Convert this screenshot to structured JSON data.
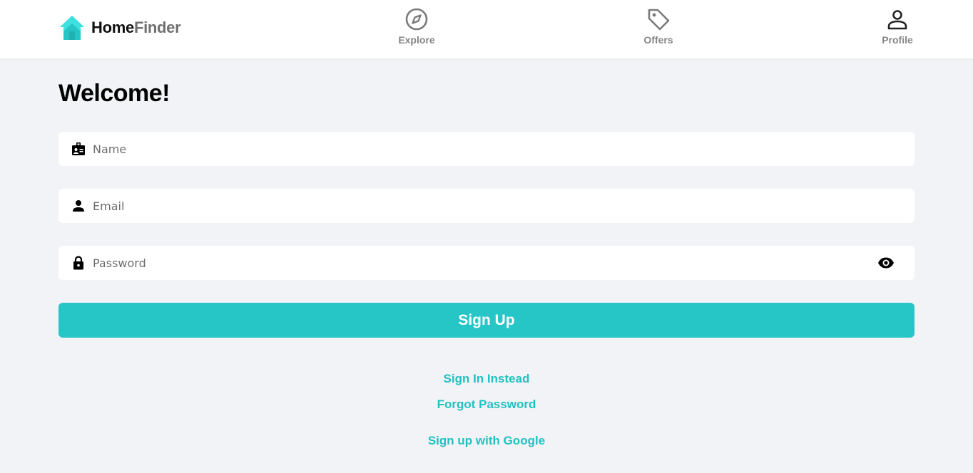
{
  "brand": {
    "name_part1": "Home",
    "name_part2": "Finder",
    "accent_color": "#26c6c6",
    "icon": "house-icon"
  },
  "nav": {
    "explore": {
      "label": "Explore",
      "icon": "compass-icon"
    },
    "offers": {
      "label": "Offers",
      "icon": "tag-icon"
    },
    "profile": {
      "label": "Profile",
      "icon": "person-icon"
    }
  },
  "page": {
    "title": "Welcome!"
  },
  "form": {
    "name": {
      "placeholder": "Name",
      "value": "",
      "icon": "id-badge-icon"
    },
    "email": {
      "placeholder": "Email",
      "value": "",
      "icon": "user-icon"
    },
    "password": {
      "placeholder": "Password",
      "value": "",
      "icon": "lock-icon",
      "toggle_icon": "eye-icon"
    },
    "submit_label": "Sign Up"
  },
  "links": {
    "sign_in": "Sign In Instead",
    "forgot": "Forgot Password",
    "google": "Sign up with Google"
  }
}
